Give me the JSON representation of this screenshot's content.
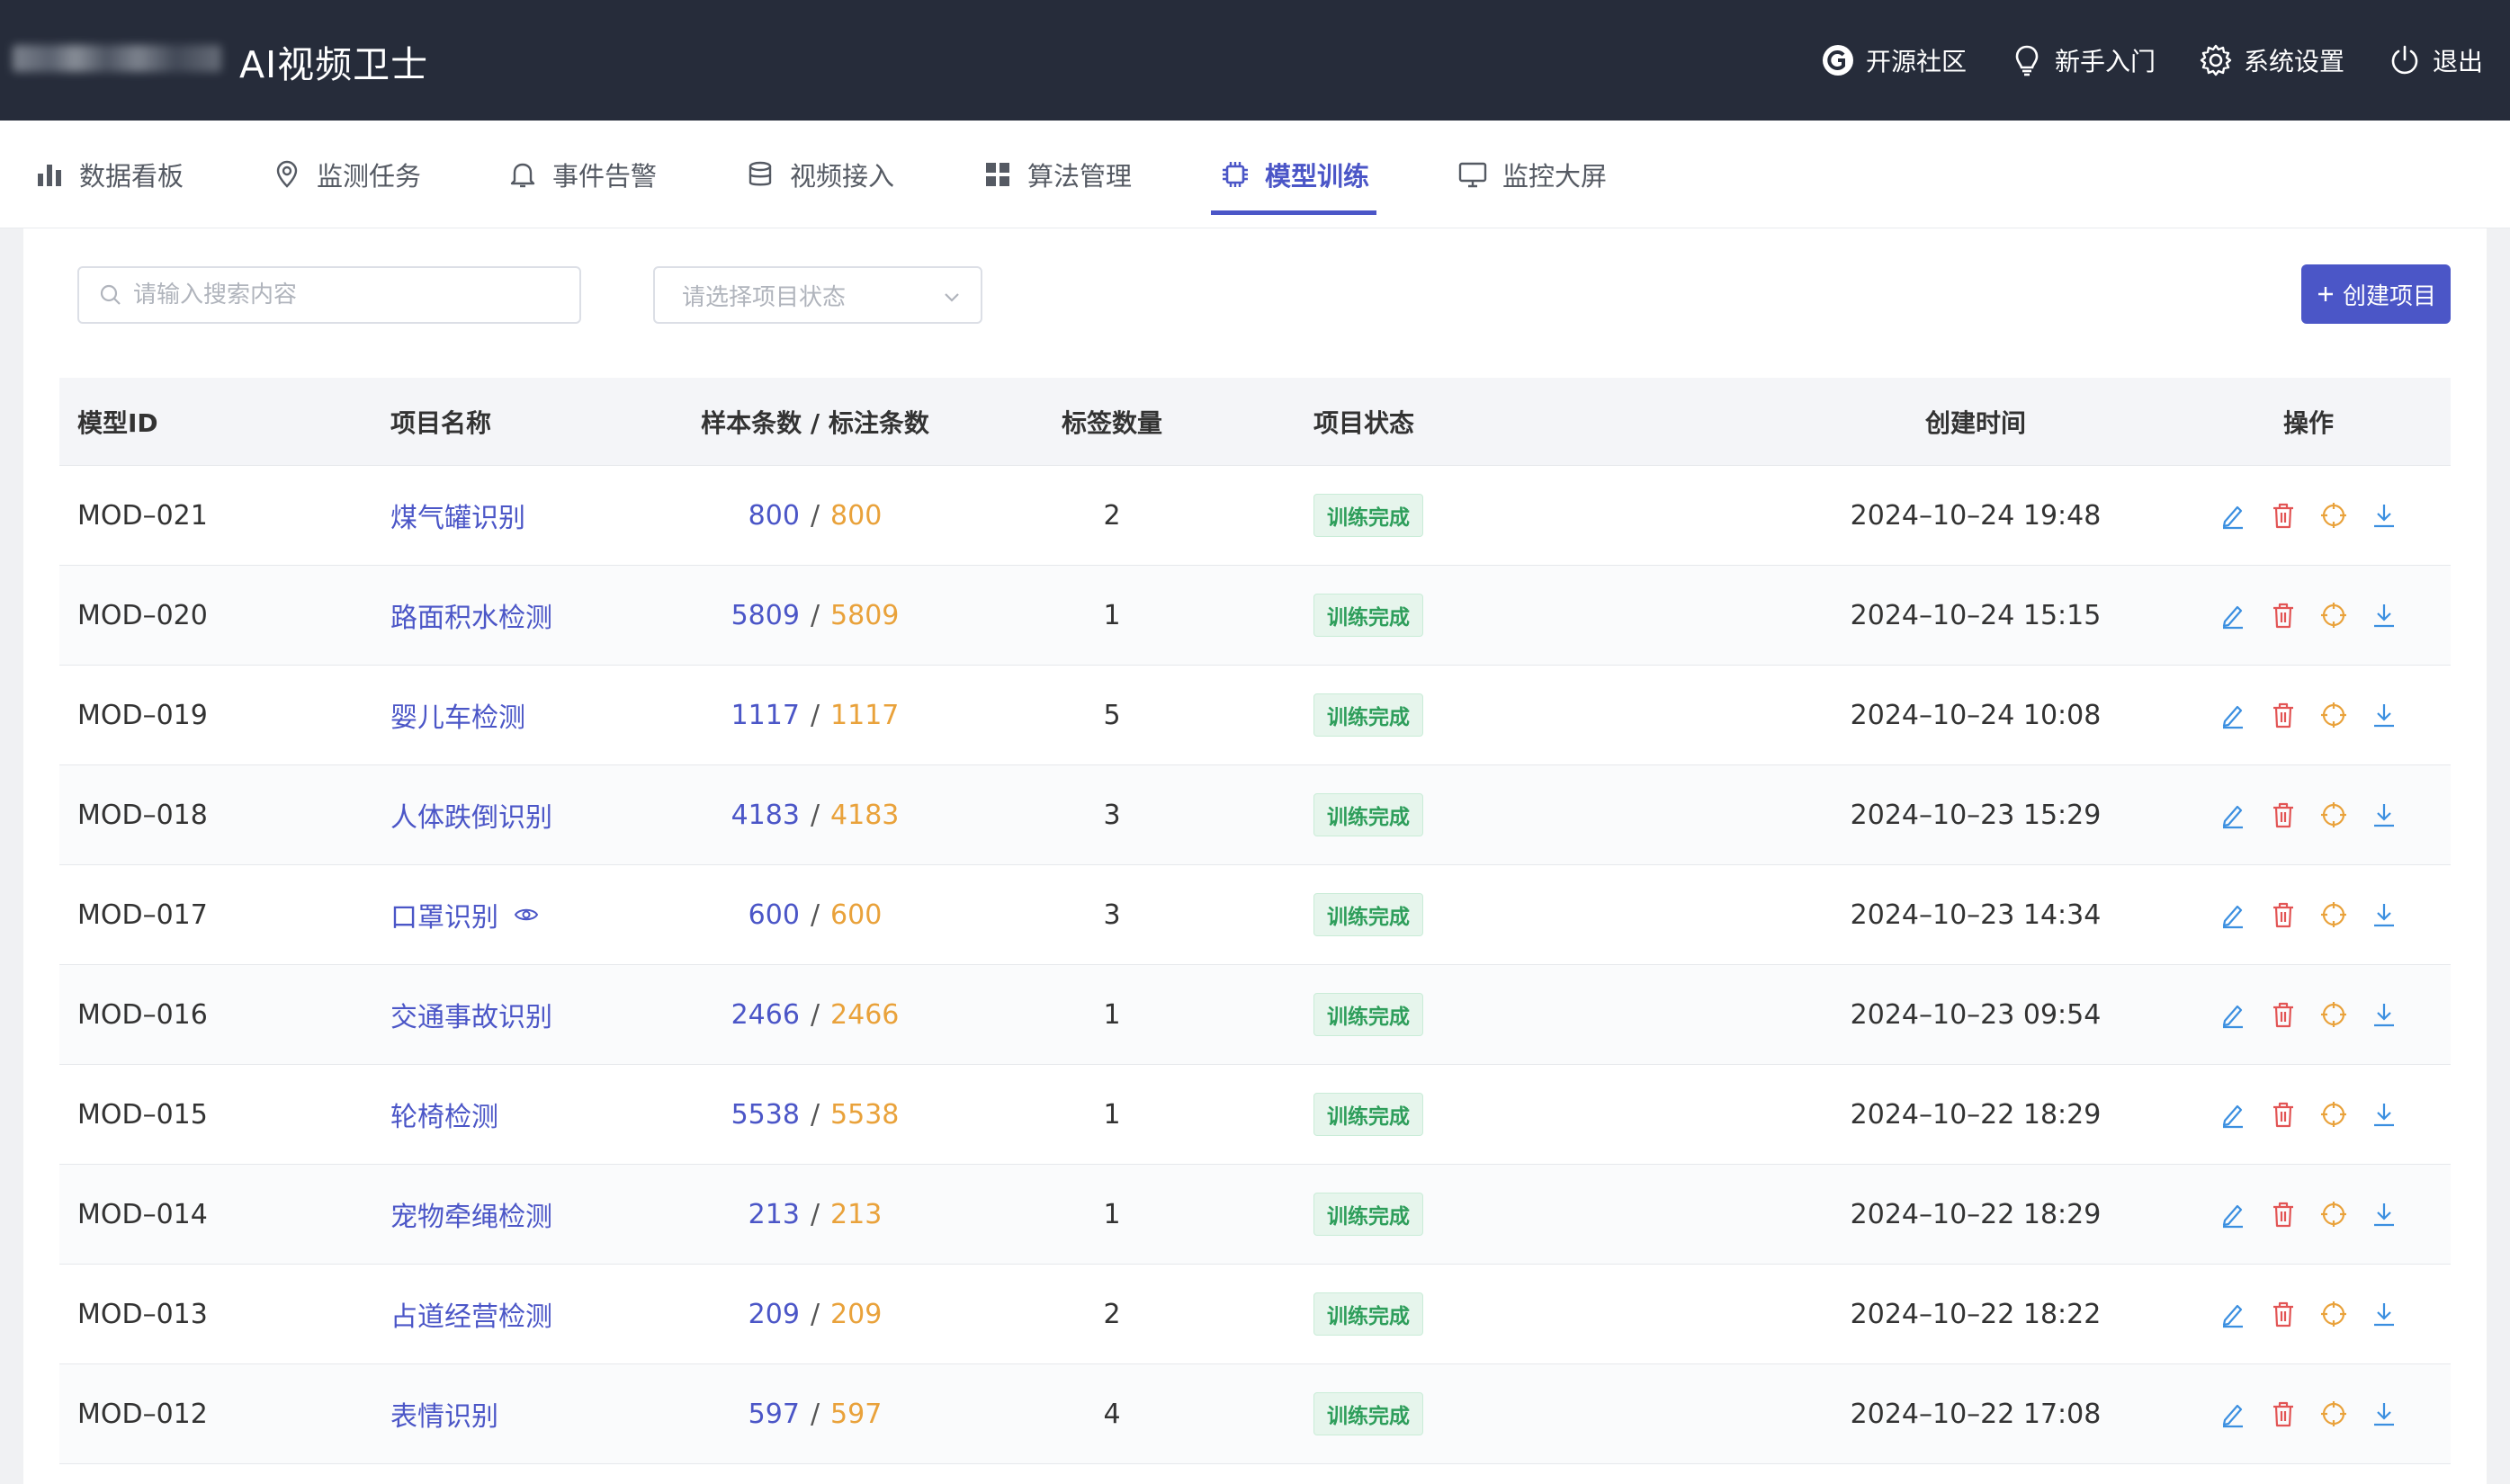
{
  "header": {
    "app_title": "AI视频卫士",
    "links": [
      {
        "label": "开源社区",
        "icon": "community-icon"
      },
      {
        "label": "新手入门",
        "icon": "lightbulb-icon"
      },
      {
        "label": "系统设置",
        "icon": "gear-icon"
      },
      {
        "label": "退出",
        "icon": "power-icon"
      }
    ]
  },
  "nav": {
    "items": [
      {
        "label": "数据看板",
        "icon": "bar-chart-icon"
      },
      {
        "label": "监测任务",
        "icon": "location-pin-icon"
      },
      {
        "label": "事件告警",
        "icon": "bell-icon"
      },
      {
        "label": "视频接入",
        "icon": "database-icon"
      },
      {
        "label": "算法管理",
        "icon": "grid-icon"
      },
      {
        "label": "模型训练",
        "icon": "chip-icon",
        "active": true
      },
      {
        "label": "监控大屏",
        "icon": "monitor-icon"
      }
    ]
  },
  "toolbar": {
    "search_placeholder": "请输入搜索内容",
    "status_placeholder": "请选择项目状态",
    "create_label": "创建项目"
  },
  "table": {
    "headers": {
      "id": "模型ID",
      "name": "项目名称",
      "counts": "样本条数 / 标注条数",
      "labels": "标签数量",
      "status": "项目状态",
      "time": "创建时间",
      "ops": "操作"
    },
    "rows": [
      {
        "id": "MOD–021",
        "name": "煤气罐识别",
        "samples": "800",
        "annotations": "800",
        "labels": "2",
        "status": "训练完成",
        "time": "2024–10–24 19:48"
      },
      {
        "id": "MOD–020",
        "name": "路面积水检测",
        "samples": "5809",
        "annotations": "5809",
        "labels": "1",
        "status": "训练完成",
        "time": "2024–10–24 15:15"
      },
      {
        "id": "MOD–019",
        "name": "婴儿车检测",
        "samples": "1117",
        "annotations": "1117",
        "labels": "5",
        "status": "训练完成",
        "time": "2024–10–24 10:08"
      },
      {
        "id": "MOD–018",
        "name": "人体跌倒识别",
        "samples": "4183",
        "annotations": "4183",
        "labels": "3",
        "status": "训练完成",
        "time": "2024–10–23 15:29"
      },
      {
        "id": "MOD–017",
        "name": "口罩识别",
        "samples": "600",
        "annotations": "600",
        "labels": "3",
        "status": "训练完成",
        "time": "2024–10–23 14:34",
        "eye": true
      },
      {
        "id": "MOD–016",
        "name": "交通事故识别",
        "samples": "2466",
        "annotations": "2466",
        "labels": "1",
        "status": "训练完成",
        "time": "2024–10–23 09:54"
      },
      {
        "id": "MOD–015",
        "name": "轮椅检测",
        "samples": "5538",
        "annotations": "5538",
        "labels": "1",
        "status": "训练完成",
        "time": "2024–10–22 18:29"
      },
      {
        "id": "MOD–014",
        "name": "宠物牵绳检测",
        "samples": "213",
        "annotations": "213",
        "labels": "1",
        "status": "训练完成",
        "time": "2024–10–22 18:29"
      },
      {
        "id": "MOD–013",
        "name": "占道经营检测",
        "samples": "209",
        "annotations": "209",
        "labels": "2",
        "status": "训练完成",
        "time": "2024–10–22 18:22"
      },
      {
        "id": "MOD–012",
        "name": "表情识别",
        "samples": "597",
        "annotations": "597",
        "labels": "4",
        "status": "训练完成",
        "time": "2024–10–22 17:08"
      }
    ]
  },
  "colors": {
    "header_bg": "#262c3a",
    "accent": "#4b56c7",
    "annotation": "#e9a23b",
    "status_green": "#2e9e5b",
    "delete_red": "#e25454",
    "edit_blue": "#3b8fe0"
  }
}
